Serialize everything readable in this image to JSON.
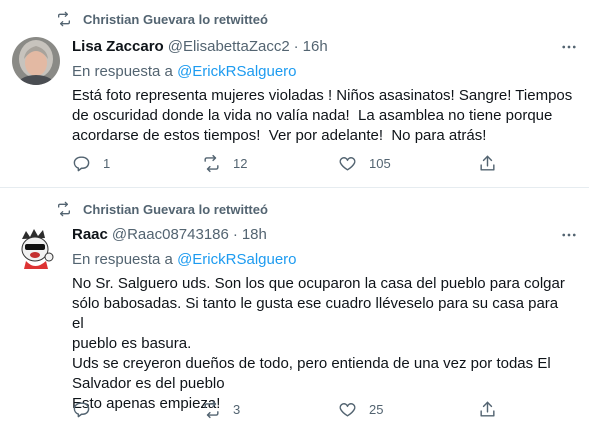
{
  "tweets": [
    {
      "retweet_label": "Christian Guevara lo retwitteó",
      "name": "Lisa Zaccaro",
      "handle": "@ElisabettaZacc2",
      "separator": "·",
      "time": "16h",
      "reply_prefix": "En respuesta a",
      "reply_mention": "@ErickRSalguero",
      "text": "Está foto representa mujeres violadas ! Niños asasinatos! Sangre! Tiempos\nde oscuridad donde la vida no valía nada!  La asamblea no tiene porque\nacordarse de estos tiempos!  Ver por adelante!  No para atrás!",
      "reply_count": "1",
      "retweet_count": "12",
      "like_count": "105"
    },
    {
      "retweet_label": "Christian Guevara lo retwitteó",
      "name": "Raac",
      "handle": "@Raac08743186",
      "separator": "·",
      "time": "18h",
      "reply_prefix": "En respuesta a",
      "reply_mention": "@ErickRSalguero",
      "text": "No Sr. Salguero uds. Son los que ocuparon la casa del pueblo para colgar\nsólo babosadas. Si tanto le gusta ese cuadro lléveselo para su casa para el\npueblo es basura.\nUds se creyeron dueños de todo, pero entienda de una vez por todas El\nSalvador es del pueblo\nEsto apenas empieza!",
      "reply_count": "",
      "retweet_count": "3",
      "like_count": "25"
    }
  ],
  "colors": {
    "secondary_text": "#536471",
    "link": "#1d9bf0",
    "divider": "#e6ecf0",
    "primary_text": "#0f1419"
  },
  "icons": [
    "retweet-icon",
    "more-icon",
    "reply-icon",
    "like-icon",
    "share-icon",
    "avatar"
  ]
}
